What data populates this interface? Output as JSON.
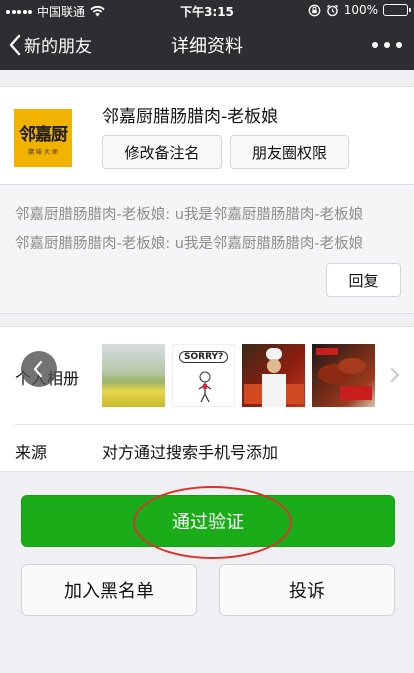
{
  "status_bar": {
    "carrier": "中国联通",
    "time": "下午3:15",
    "battery": "100%",
    "icons": [
      "signal-dots-icon",
      "wifi-icon",
      "orientation-lock-icon",
      "alarm-icon",
      "battery-icon"
    ]
  },
  "nav": {
    "back_label": "新的朋友",
    "title": "详细资料",
    "more_icon": "more-dots-icon"
  },
  "profile": {
    "avatar_text": "邻嘉厨",
    "avatar_subtext": "腊 味 大 师",
    "name": "邻嘉厨腊肠腊肉-老板娘",
    "edit_remark_label": "修改备注名",
    "moments_permission_label": "朋友圈权限"
  },
  "verification": {
    "messages": [
      "邻嘉厨腊肠腊肉-老板娘: u我是邻嘉厨腊肠腊肉-老板娘",
      "邻嘉厨腊肠腊肉-老板娘: u我是邻嘉厨腊肠腊肉-老板娘"
    ],
    "reply_label": "回复"
  },
  "info": {
    "album_label": "个人相册",
    "album_thumbs": [
      "flower-field-photo",
      "sorry-cartoon-photo",
      "chef-promo-photo",
      "cured-meat-photo"
    ],
    "sorry_text": "SORRY?",
    "source_label": "来源",
    "source_value": "对方通过搜索手机号添加"
  },
  "actions": {
    "accept_label": "通过验证",
    "blacklist_label": "加入黑名单",
    "report_label": "投诉"
  },
  "colors": {
    "nav_bg": "#2e2e32",
    "accept_green": "#1aad19",
    "annotation_red": "#d8352a",
    "page_bg": "#efeff4"
  }
}
